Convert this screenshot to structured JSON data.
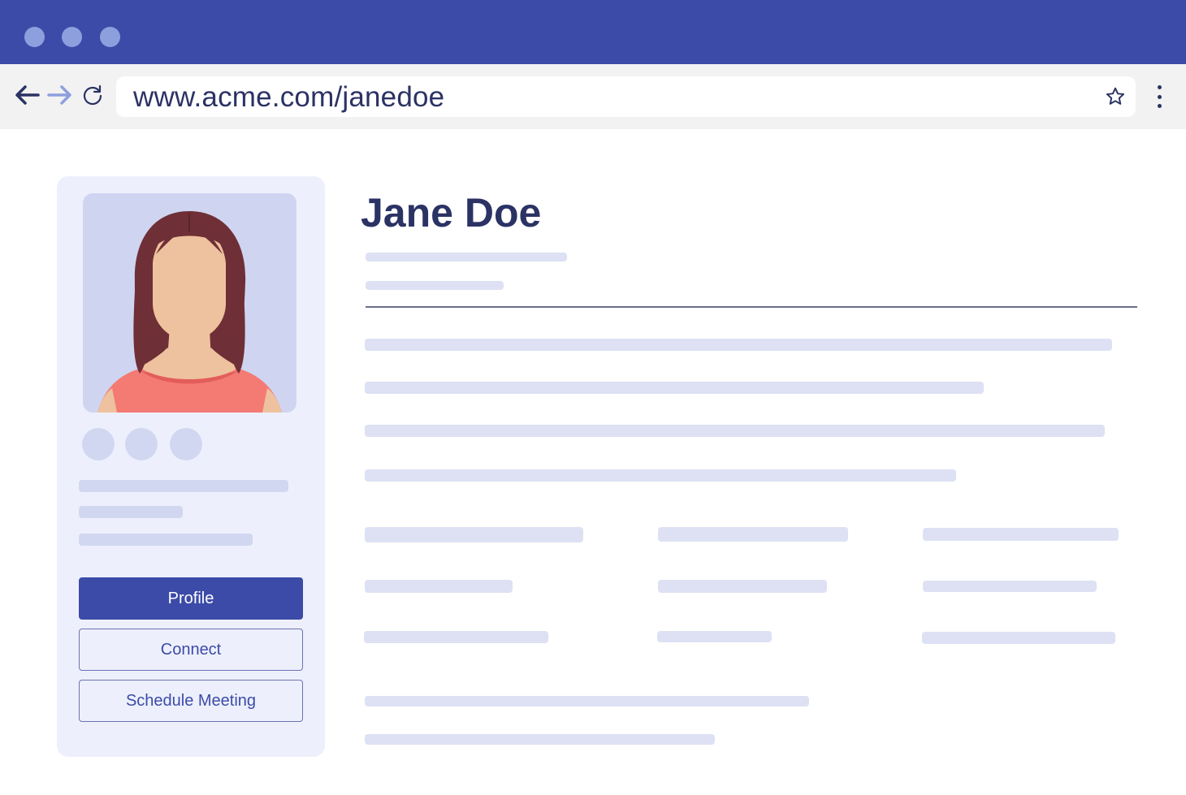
{
  "browser": {
    "url": "www.acme.com/janedoe",
    "window_dots": 3,
    "accent_color": "#3c4ba8"
  },
  "profile": {
    "name": "Jane Doe"
  },
  "actions": {
    "profile_label": "Profile",
    "connect_label": "Connect",
    "schedule_label": "Schedule Meeting"
  },
  "icons": {
    "back": "arrow-left-icon",
    "forward": "arrow-right-icon",
    "reload": "reload-icon",
    "bookmark": "star-icon",
    "menu": "more-vertical-icon"
  }
}
